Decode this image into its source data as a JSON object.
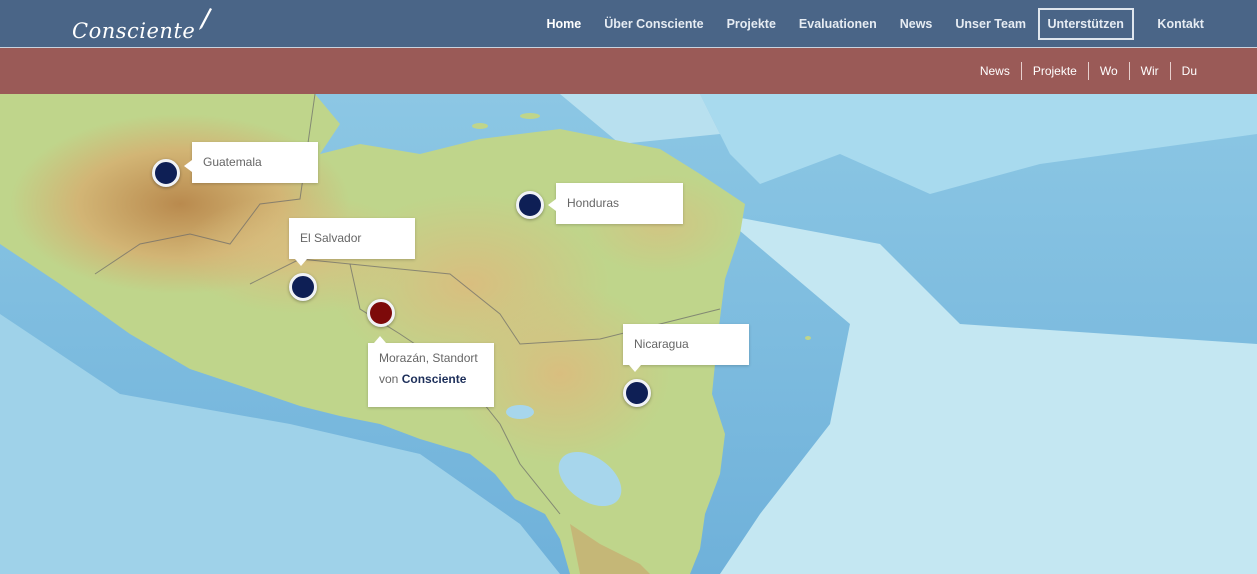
{
  "brand": {
    "logo_text": "Consciente"
  },
  "main_nav": [
    {
      "label": "Home",
      "active": true
    },
    {
      "label": "Über Consciente"
    },
    {
      "label": "Projekte"
    },
    {
      "label": "Evaluationen"
    },
    {
      "label": "News"
    },
    {
      "label": "Unser Team"
    },
    {
      "label": "Unterstützen",
      "boxed": true
    },
    {
      "label": "Kontakt"
    }
  ],
  "sub_nav": [
    "News",
    "Projekte",
    "Wo",
    "Wir",
    "Du"
  ],
  "map": {
    "markers": [
      {
        "label": "Guatemala",
        "color": "#0e1f55"
      },
      {
        "label": "Honduras",
        "color": "#0e1f55"
      },
      {
        "label": "El Salvador",
        "color": "#0e1f55"
      },
      {
        "label_line1": "Morazán, Standort",
        "label_line2_prefix": "von",
        "label_line2_strong": "Consciente",
        "color": "#7d0a0a"
      },
      {
        "label": "Nicaragua",
        "color": "#0e1f55"
      }
    ]
  },
  "colors": {
    "topbar": "#4a6587",
    "subbar": "#9a5a57",
    "ocean_shallow": "#bfe3ef",
    "ocean_deep": "#79b9dc",
    "land": "#c9d88f",
    "highlands": "#c9a46a"
  }
}
